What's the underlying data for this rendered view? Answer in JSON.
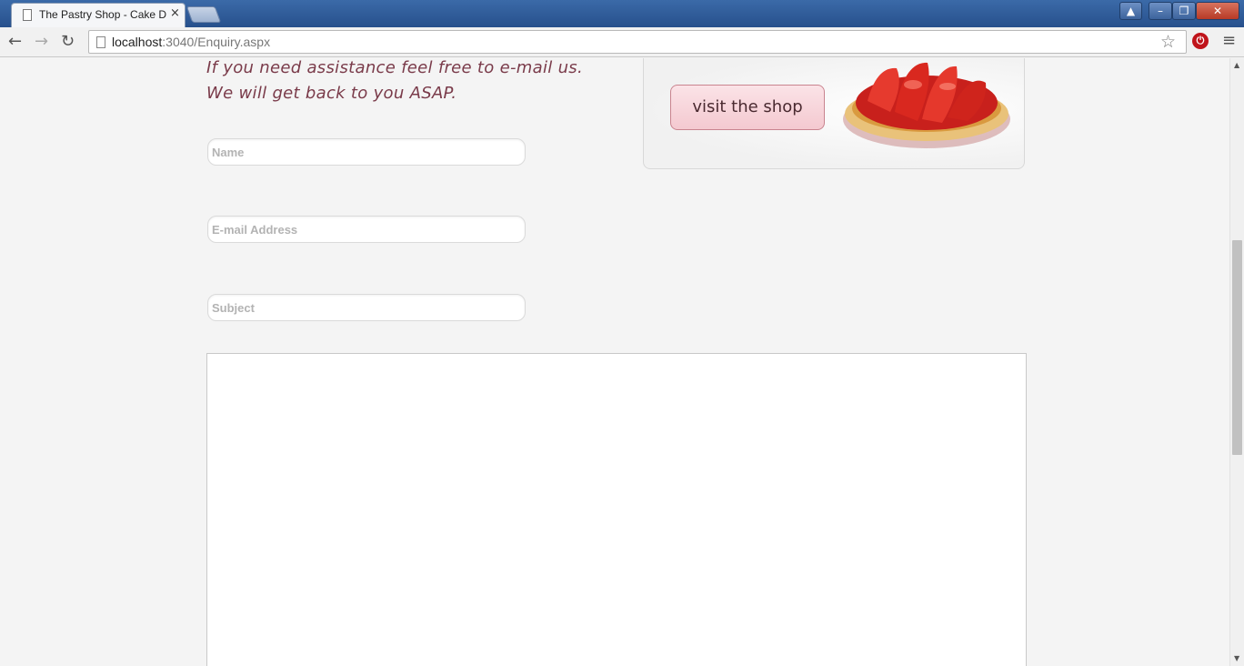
{
  "browser": {
    "tab_title": "The Pastry Shop - Cake De",
    "tab_close": "×",
    "url_host": "localhost",
    "url_rest": ":3040/Enquiry.aspx",
    "window_buttons": {
      "minimize": "–",
      "maximize": "❐",
      "close": "✕",
      "user": "▲"
    },
    "nav": {
      "back": "←",
      "forward": "→",
      "reload": "↻",
      "star": "☆",
      "menu": "≡",
      "extension": "⏻"
    }
  },
  "page": {
    "intro_line1": "If you need assistance feel free to e-mail us.",
    "intro_line2": "We will get back to you ASAP.",
    "form": {
      "name_placeholder": "Name",
      "email_placeholder": "E-mail Address",
      "subject_placeholder": "Subject",
      "message_value": ""
    },
    "shop_button": "visit the shop"
  },
  "colors": {
    "intro_text": "#7a3b4a",
    "shop_button_bg": "#f4c9d0",
    "page_bg": "#f4f4f4"
  },
  "scrollbar": {
    "up": "▲",
    "down": "▼"
  }
}
